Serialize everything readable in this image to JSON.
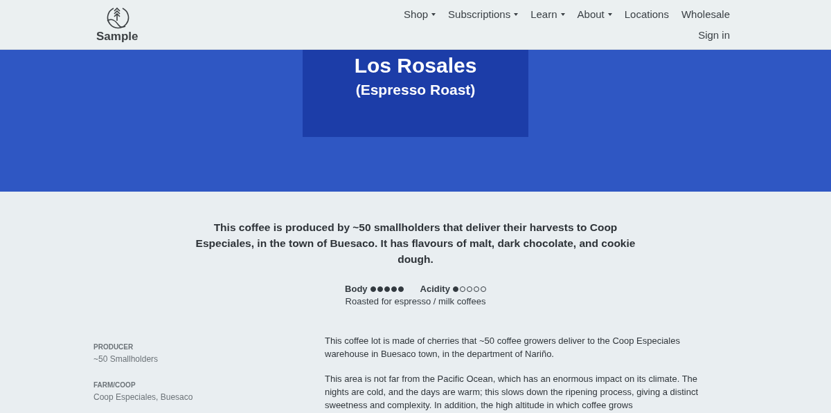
{
  "header": {
    "logo_text": "Sample",
    "nav": [
      {
        "label": "Shop",
        "dropdown": true
      },
      {
        "label": "Subscriptions",
        "dropdown": true
      },
      {
        "label": "Learn",
        "dropdown": true
      },
      {
        "label": "About",
        "dropdown": true
      },
      {
        "label": "Locations",
        "dropdown": false
      },
      {
        "label": "Wholesale",
        "dropdown": false
      }
    ],
    "sign_in": "Sign in"
  },
  "hero": {
    "title": "Los Rosales",
    "subtitle": "(Espresso Roast)"
  },
  "intro": "This coffee is produced by ~50 smallholders that deliver their harvests to Coop Especiales, in the town of Buesaco. It has flavours of malt, dark chocolate, and cookie dough.",
  "ratings": [
    {
      "label": "Body",
      "stars": 5
    },
    {
      "label": "Acidity",
      "stars": 1
    }
  ],
  "roast_note": "Roasted for espresso / milk coffees",
  "details": [
    {
      "label": "PRODUCER",
      "value": "~50 Smallholders"
    },
    {
      "label": "FARM/COOP",
      "value": "Coop Especiales, Buesaco"
    }
  ],
  "description": [
    "This coffee lot is made of cherries that ~50 coffee growers deliver to the Coop Especiales warehouse in Buesaco town, in the department of Nariño.",
    "This area is not far from the Pacific Ocean, which has an enormous impact on its climate. The nights are cold, and the days are warm; this slows down the ripening process, giving a distinct sweetness and complexity. In addition, the high altitude in which coffee grows"
  ]
}
